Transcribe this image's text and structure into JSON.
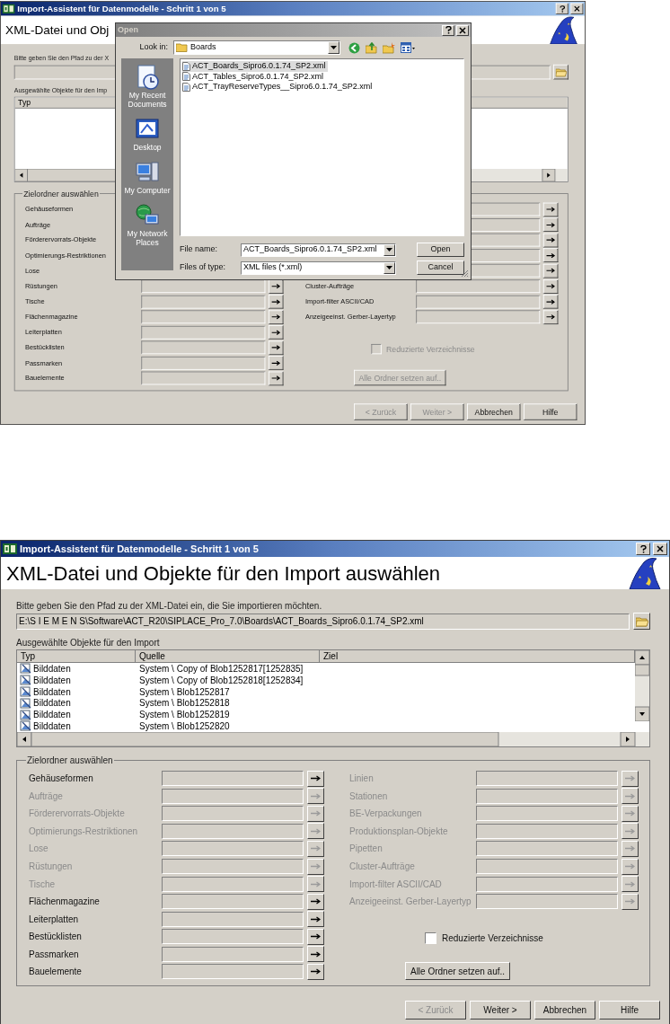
{
  "top_dialog": {
    "title": "Import-Assistent für Datenmodelle - Schritt 1 von 5",
    "heading": "XML-Datei und Obj",
    "path_label": "Bitte geben Sie den Pfad zu der X",
    "objects_label": "Ausgewählte Objekte für den Imp",
    "table": {
      "columns": [
        "Typ"
      ]
    },
    "group_title": "Zielordner auswählen",
    "left_rows": [
      {
        "label": "Gehäuseformen",
        "disabled": false
      },
      {
        "label": "Aufträge",
        "disabled": false
      },
      {
        "label": "Förderervorrats-Objekte",
        "disabled": false
      },
      {
        "label": "Optimierungs-Restriktionen",
        "disabled": false
      },
      {
        "label": "Lose",
        "disabled": false
      },
      {
        "label": "Rüstungen",
        "disabled": false
      },
      {
        "label": "Tische",
        "disabled": false
      },
      {
        "label": "Flächenmagazine",
        "disabled": false
      },
      {
        "label": "Leiterplatten",
        "disabled": false
      },
      {
        "label": "Bestücklisten",
        "disabled": false
      },
      {
        "label": "Passmarken",
        "disabled": false
      },
      {
        "label": "Bauelemente",
        "disabled": false
      }
    ],
    "right_rows": [
      {
        "disabled": false
      },
      {
        "disabled": false
      },
      {
        "disabled": false
      },
      {
        "disabled": false
      },
      {
        "disabled": false
      },
      {
        "label": "Cluster-Aufträge",
        "disabled": false
      },
      {
        "label": "Import-filter ASCII/CAD",
        "disabled": false
      },
      {
        "label": "Anzeigeeinst. Gerber-Layertyp",
        "disabled": false
      }
    ],
    "checkbox": {
      "label": "Reduzierte Verzeichnisse",
      "checked": false,
      "disabled": true
    },
    "set_all_button": {
      "label": "Alle Ordner setzen auf..",
      "disabled": true
    },
    "buttons": [
      {
        "label": "< Zurück",
        "disabled": true
      },
      {
        "label": "Weiter >",
        "disabled": true
      },
      {
        "label": "Abbrechen",
        "disabled": false
      },
      {
        "label": "Hilfe",
        "disabled": false
      }
    ],
    "open_dialog": {
      "title": "Open",
      "look_in_label": "Look in:",
      "look_in": "Boards",
      "places": [
        {
          "kind": "recent",
          "label": "My Recent Documents"
        },
        {
          "kind": "desktop",
          "label": "Desktop"
        },
        {
          "kind": "computer",
          "label": "My Computer"
        },
        {
          "kind": "network",
          "label": "My Network Places"
        }
      ],
      "files": [
        {
          "name": "ACT_Boards_Sipro6.0.1.74_SP2.xml",
          "selected": true
        },
        {
          "name": "ACT_Tables_Sipro6.0.1.74_SP2.xml",
          "selected": false
        },
        {
          "name": "ACT_TrayReserveTypes__Sipro6.0.1.74_SP2.xml",
          "selected": false
        }
      ],
      "file_name_label": "File name:",
      "file_name": "ACT_Boards_Sipro6.0.1.74_SP2.xml",
      "file_type_label": "Files of type:",
      "file_type": "XML files (*.xml)",
      "buttons": [
        "Open",
        "Cancel"
      ]
    }
  },
  "bottom_dialog": {
    "title": "Import-Assistent für Datenmodelle - Schritt 1 von 5",
    "heading": "XML-Datei und Objekte für den Import auswählen",
    "path_label": "Bitte geben Sie den Pfad zu der XML-Datei ein, die Sie importieren möchten.",
    "path": "E:\\S I E M E N S\\Software\\ACT_R20\\SIPLACE_Pro_7.0\\Boards\\ACT_Boards_Sipro6.0.1.74_SP2.xml",
    "objects_label": "Ausgewählte Objekte für den Import",
    "table": {
      "columns": [
        "Typ",
        "Quelle",
        "Ziel"
      ],
      "rows": [
        [
          "Bilddaten",
          "System \\ Copy of Blob1252817[1252835]"
        ],
        [
          "Bilddaten",
          "System \\ Copy of Blob1252818[1252834]"
        ],
        [
          "Bilddaten",
          "System \\ Blob1252817"
        ],
        [
          "Bilddaten",
          "System \\ Blob1252818"
        ],
        [
          "Bilddaten",
          "System \\ Blob1252819"
        ],
        [
          "Bilddaten",
          "System \\ Blob1252820"
        ]
      ]
    },
    "group_title": "Zielordner auswählen",
    "left_rows": [
      {
        "label": "Gehäuseformen",
        "disabled": false
      },
      {
        "label": "Aufträge",
        "disabled": true
      },
      {
        "label": "Förderervorrats-Objekte",
        "disabled": true
      },
      {
        "label": "Optimierungs-Restriktionen",
        "disabled": true
      },
      {
        "label": "Lose",
        "disabled": true
      },
      {
        "label": "Rüstungen",
        "disabled": true
      },
      {
        "label": "Tische",
        "disabled": true
      },
      {
        "label": "Flächenmagazine",
        "disabled": false
      },
      {
        "label": "Leiterplatten",
        "disabled": false
      },
      {
        "label": "Bestücklisten",
        "disabled": false
      },
      {
        "label": "Passmarken",
        "disabled": false
      },
      {
        "label": "Bauelemente",
        "disabled": false
      }
    ],
    "right_rows": [
      {
        "label": "Linien",
        "disabled": true
      },
      {
        "label": "Stationen",
        "disabled": true
      },
      {
        "label": "BE-Verpackungen",
        "disabled": true
      },
      {
        "label": "Produktionsplan-Objekte",
        "disabled": true
      },
      {
        "label": "Pipetten",
        "disabled": true
      },
      {
        "label": "Cluster-Aufträge",
        "disabled": true
      },
      {
        "label": "Import-filter ASCII/CAD",
        "disabled": true
      },
      {
        "label": "Anzeigeeinst. Gerber-Layertyp",
        "disabled": true
      }
    ],
    "checkbox": {
      "label": "Reduzierte Verzeichnisse",
      "checked": false,
      "disabled": false
    },
    "set_all_button": {
      "label": "Alle Ordner setzen auf..",
      "disabled": false
    },
    "buttons": [
      {
        "label": "< Zurück",
        "disabled": true
      },
      {
        "label": "Weiter >",
        "disabled": false
      },
      {
        "label": "Abbrechen",
        "disabled": false
      },
      {
        "label": "Hilfe",
        "disabled": false
      }
    ]
  }
}
